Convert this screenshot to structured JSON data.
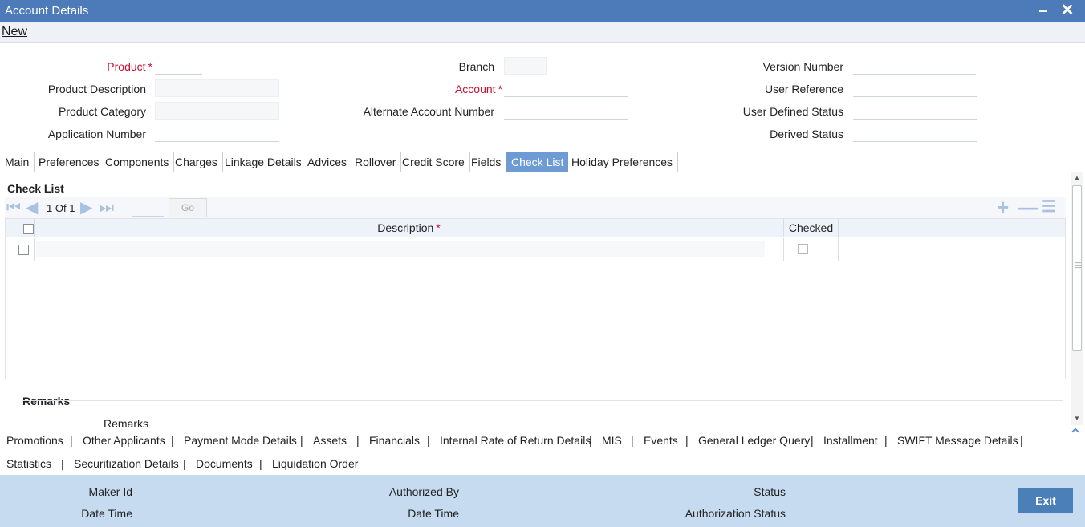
{
  "window": {
    "title": "Account Details",
    "minimize_icon": "minimize-icon",
    "close_icon": "close-icon"
  },
  "menu": {
    "new_label": "New"
  },
  "fields": {
    "product": {
      "label": "Product",
      "required": "*"
    },
    "product_description": {
      "label": "Product Description"
    },
    "product_category": {
      "label": "Product Category"
    },
    "application_number": {
      "label": "Application Number"
    },
    "branch": {
      "label": "Branch"
    },
    "account": {
      "label": "Account",
      "required": "*"
    },
    "alternate_account_number": {
      "label": "Alternate Account Number"
    },
    "version_number": {
      "label": "Version Number"
    },
    "user_reference": {
      "label": "User Reference"
    },
    "user_defined_status": {
      "label": "User Defined Status"
    },
    "derived_status": {
      "label": "Derived Status"
    }
  },
  "tabs": [
    "Main",
    "Preferences",
    "Components",
    "Charges",
    "Linkage Details",
    "Advices",
    "Rollover",
    "Credit Score",
    "Fields",
    "Check List",
    "Holiday Preferences"
  ],
  "active_tab": "Check List",
  "checklist": {
    "title": "Check List",
    "pagination": {
      "current": "1",
      "of_label": "Of",
      "total": "1",
      "go_label": "Go"
    },
    "columns": {
      "description": "Description",
      "description_required": "*",
      "checked": "Checked"
    },
    "rows": [
      {
        "description": "",
        "checked": false
      }
    ]
  },
  "remarks": {
    "section_title": "Remarks",
    "label": "Remarks"
  },
  "links_row1": [
    "Promotions",
    "Other Applicants",
    "Payment Mode Details",
    "Assets",
    "Financials",
    "Internal Rate of Return Details",
    "MIS",
    "Events",
    "General Ledger Query",
    "Installment",
    "SWIFT Message Details"
  ],
  "links_row2": [
    "Statistics",
    "Securitization Details",
    "Documents",
    "Liquidation Order"
  ],
  "footer": {
    "maker_id": "Maker Id",
    "date_time_1": "Date Time",
    "authorized_by": "Authorized By",
    "date_time_2": "Date Time",
    "status": "Status",
    "authorization_status": "Authorization Status",
    "exit_label": "Exit"
  },
  "colors": {
    "titlebar": "#4d7ab8",
    "active_tab": "#6e9bd3",
    "footer": "#c6dbef",
    "required": "#c8102e",
    "exit_button": "#4a7fb8"
  }
}
